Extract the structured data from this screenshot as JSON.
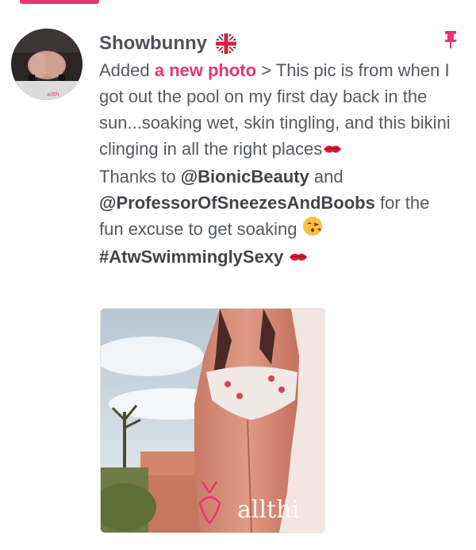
{
  "colors": {
    "accent": "#e8366f",
    "text": "#555a61",
    "mention": "#40454b"
  },
  "post": {
    "username": "Showbunny",
    "flag_icon": "uk-flag-icon",
    "pin_icon": "pin-icon",
    "action_prefix": "Added ",
    "action_link": "a new photo",
    "action_sep": " > ",
    "body_line1": "This pic is from when I got out the pool on my first day back in the sun...soaking wet, skin tingling, and this bikini clinging in all the right places",
    "thanks_prefix": "Thanks to ",
    "mention1": "@BionicBeauty",
    "and_word": " and",
    "mention2": "@ProfessorOfSneezesAndBoobs",
    "for_text": " for the fun excuse to get soaking ",
    "hashtag": "#AtwSwimminglySexy"
  },
  "photo": {
    "watermark": "allthi"
  },
  "avatar": {
    "watermark": "allth"
  }
}
